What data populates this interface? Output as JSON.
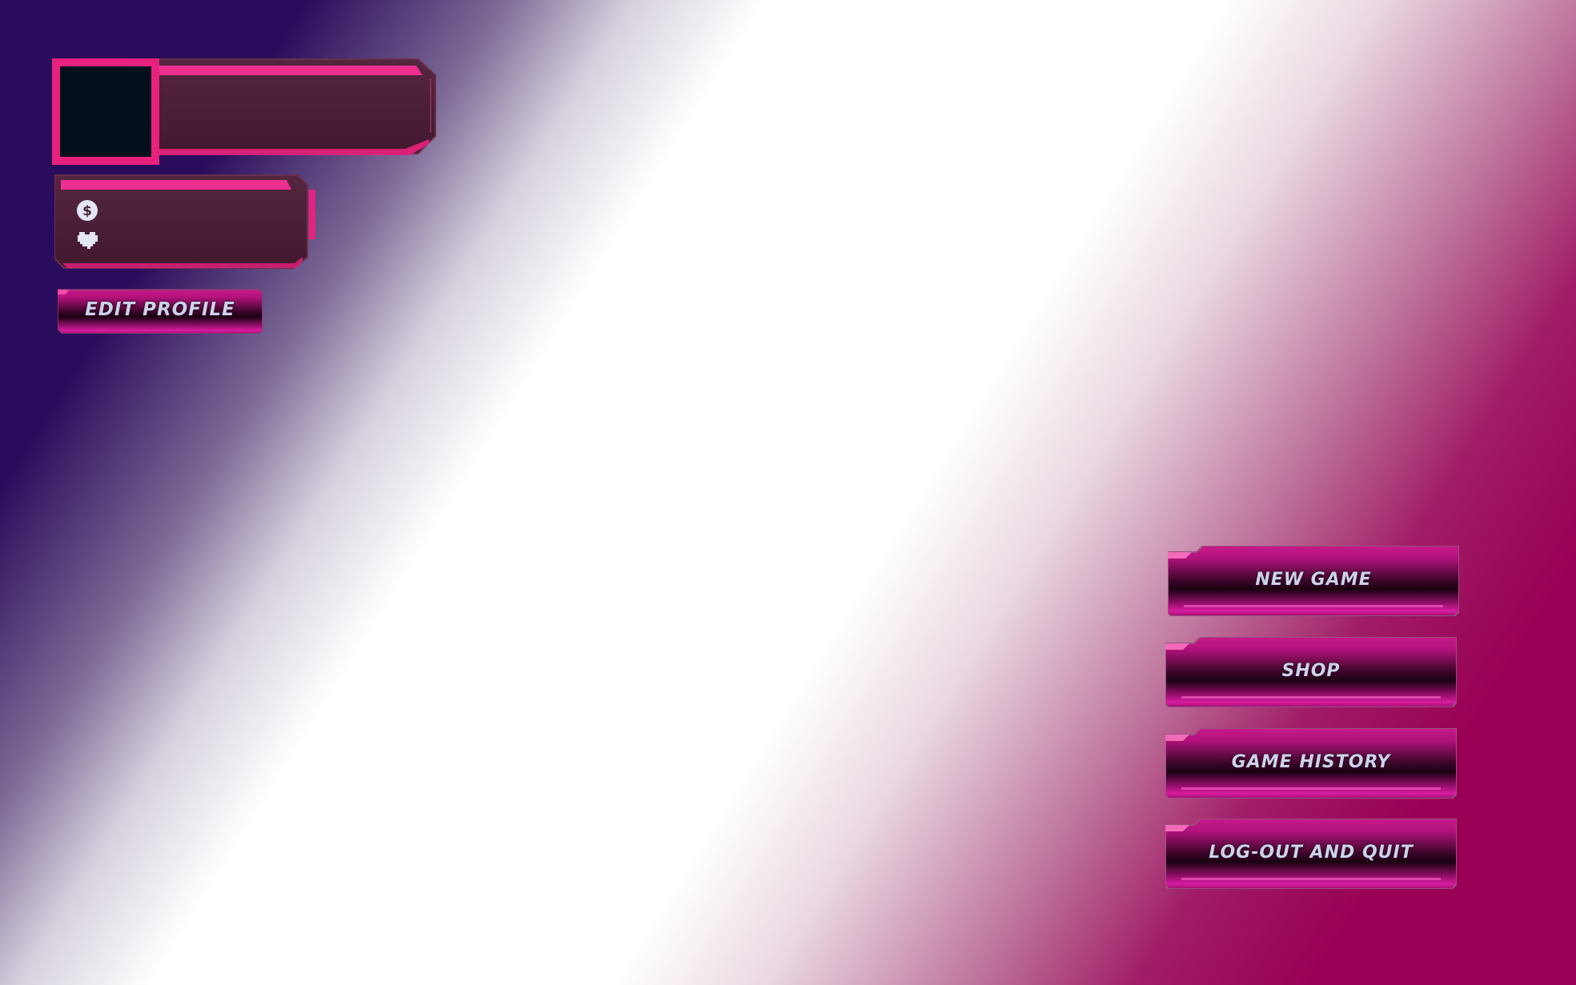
{
  "profile": {
    "player_name": "",
    "avatar": "empty-avatar-slot"
  },
  "stats": {
    "coins": {
      "icon": "coin-icon",
      "value": ""
    },
    "lives": {
      "icon": "heart-icon",
      "value": ""
    }
  },
  "buttons": {
    "edit_profile": "EDIT PROFILE",
    "new_game": "NEW GAME",
    "shop": "SHOP",
    "game_history": "GAME HISTORY",
    "logout_quit": "LOG-OUT AND QUIT"
  },
  "colors": {
    "accent_pink": "#e8217e",
    "panel_fill": "#4a2236",
    "button_magenta": "#c0127f",
    "label_text": "#ccd2ea",
    "background_top_left": "#2a0c5c",
    "background_bottom_right": "#990055"
  }
}
